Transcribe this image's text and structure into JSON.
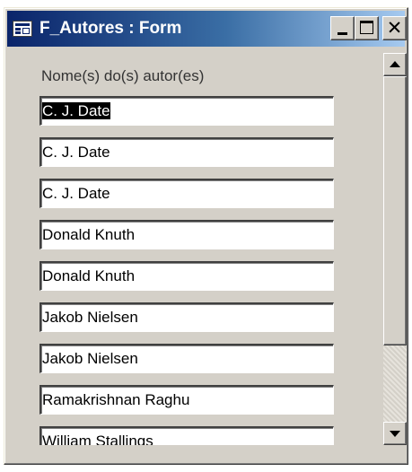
{
  "window": {
    "title": "F_Autores : Form",
    "close_glyph": "✕"
  },
  "form": {
    "field_label": "Nome(s) do(s) autor(es)",
    "rows": [
      "C. J. Date",
      "C. J. Date",
      "C. J. Date",
      "Donald Knuth",
      "Donald Knuth",
      "Jakob Nielsen",
      "Jakob Nielsen",
      "Ramakrishnan Raghu",
      "William Stallings"
    ],
    "selected_row_index": 0
  },
  "colors": {
    "titlebar_start": "#0a246a",
    "titlebar_end": "#a6caf0",
    "face": "#d4d0c8",
    "selection": "#000000"
  },
  "icons": [
    "form-icon",
    "minimize-icon",
    "maximize-icon",
    "close-icon",
    "scroll-up-arrow-icon",
    "scroll-down-arrow-icon"
  ]
}
